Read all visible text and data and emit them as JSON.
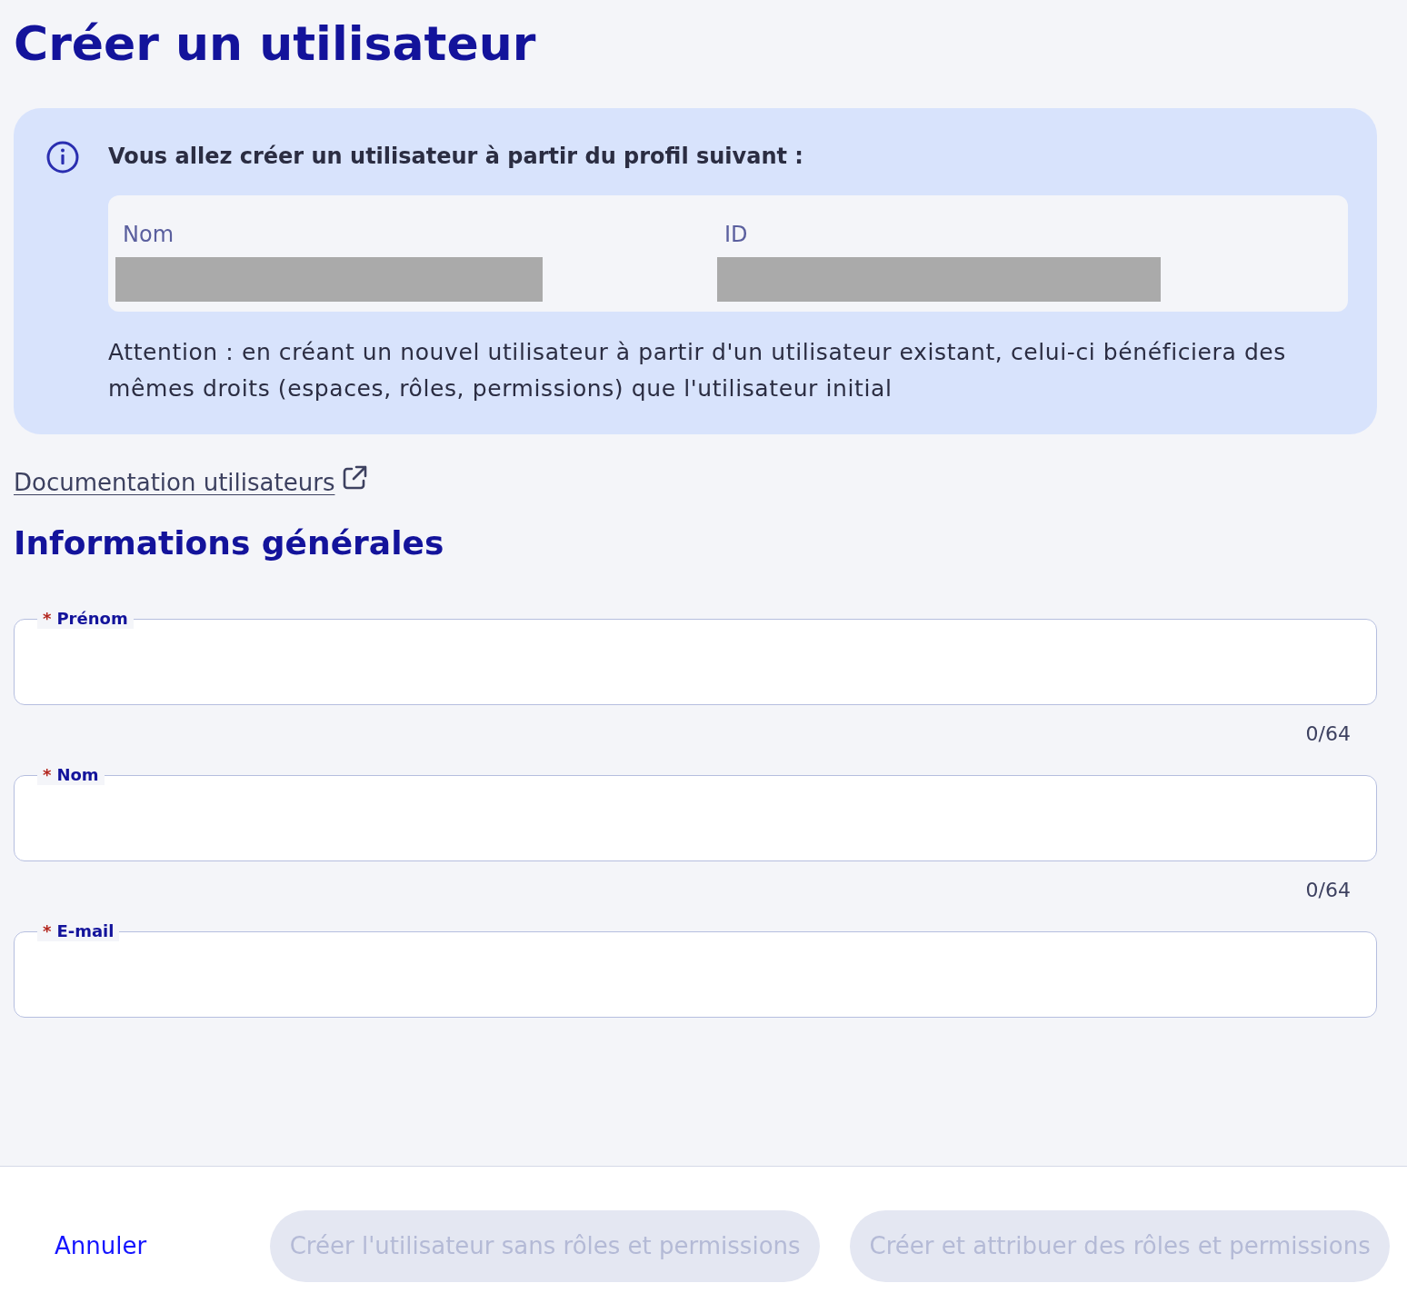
{
  "title": "Créer un utilisateur",
  "notice": {
    "heading": "Vous allez créer un utilisateur à partir du profil suivant :",
    "profile": [
      {
        "label": "Nom",
        "redacted": true
      },
      {
        "label": "ID",
        "redacted": true
      }
    ],
    "warning": "Attention : en créant un nouvel utilisateur à partir d'un utilisateur existant, celui-ci bénéficiera des mêmes droits (espaces, rôles, permissions) que l'utilisateur initial"
  },
  "doc_link": {
    "label": "Documentation utilisateurs",
    "external": true
  },
  "section_title": "Informations générales",
  "fields": [
    {
      "label": "Prénom",
      "required_mark": "*",
      "counter": "0/64"
    },
    {
      "label": "Nom",
      "required_mark": "*",
      "counter": "0/64"
    },
    {
      "label": "E-mail",
      "required_mark": "*"
    }
  ],
  "footer": {
    "cancel": "Annuler",
    "buttons": [
      {
        "label": "Créer l'utilisateur sans rôles et permissions",
        "disabled": true
      },
      {
        "label": "Créer et attribuer des rôles et permissions",
        "disabled": true
      }
    ]
  }
}
